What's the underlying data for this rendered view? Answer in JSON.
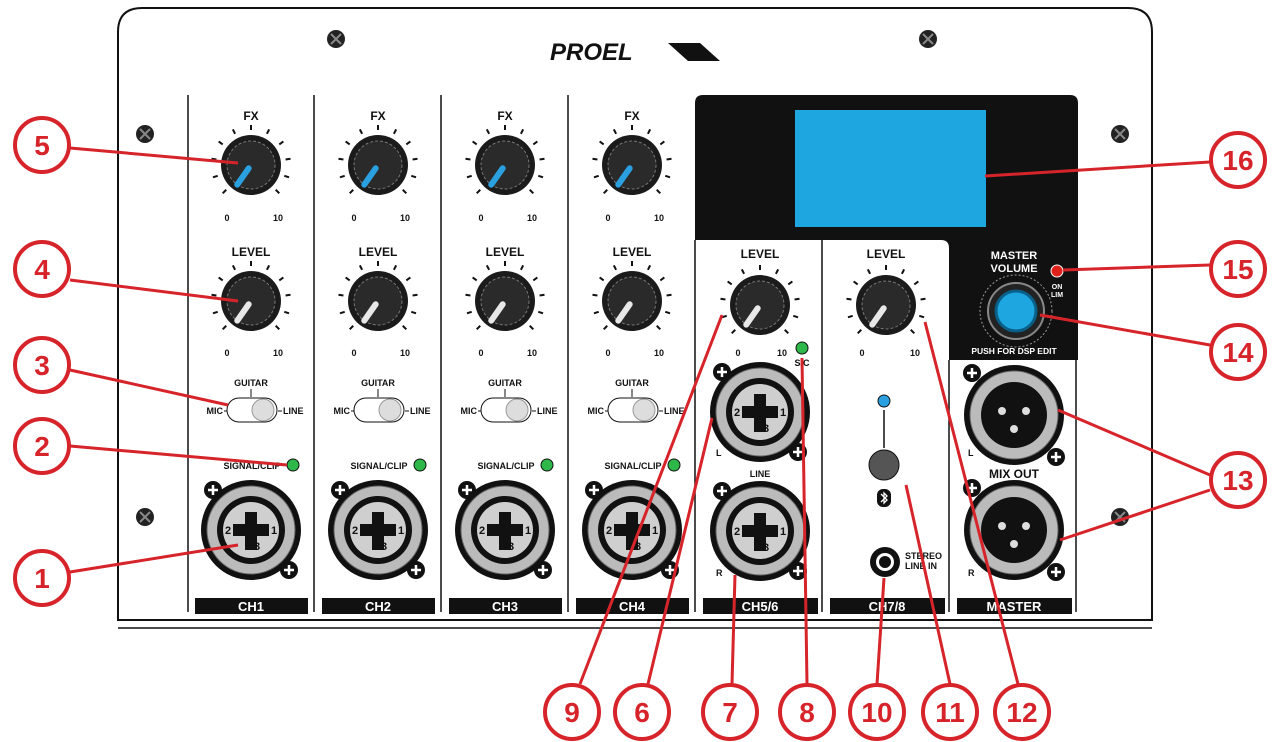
{
  "brand": "PROEL",
  "channels": [
    {
      "id": "CH1",
      "fx_label": "FX",
      "level_label": "LEVEL",
      "switch_top": "GUITAR",
      "switch_left": "MIC",
      "switch_right": "LINE",
      "signal_label": "SIGNAL/CLIP"
    },
    {
      "id": "CH2",
      "fx_label": "FX",
      "level_label": "LEVEL",
      "switch_top": "GUITAR",
      "switch_left": "MIC",
      "switch_right": "LINE",
      "signal_label": "SIGNAL/CLIP"
    },
    {
      "id": "CH3",
      "fx_label": "FX",
      "level_label": "LEVEL",
      "switch_top": "GUITAR",
      "switch_left": "MIC",
      "switch_right": "LINE",
      "signal_label": "SIGNAL/CLIP"
    },
    {
      "id": "CH4",
      "fx_label": "FX",
      "level_label": "LEVEL",
      "switch_top": "GUITAR",
      "switch_left": "MIC",
      "switch_right": "LINE",
      "signal_label": "SIGNAL/CLIP"
    }
  ],
  "scale": {
    "min": "0",
    "max": "10"
  },
  "ch56": {
    "id": "CH5/6",
    "level_label": "LEVEL",
    "sc_label": "S/C",
    "line_label": "LINE",
    "left_label": "L",
    "right_label": "R"
  },
  "ch78": {
    "id": "CH7/8",
    "level_label": "LEVEL",
    "stereo_line_in": [
      "STEREO",
      "LINE IN"
    ]
  },
  "master": {
    "id": "MASTER",
    "volume_label": [
      "MASTER",
      "VOLUME"
    ],
    "on_lim": [
      "ON",
      "LIM"
    ],
    "push_label": "PUSH FOR DSP EDIT",
    "mix_out": "MIX OUT",
    "left_label": "L",
    "right_label": "R"
  },
  "callouts": [
    "1",
    "2",
    "3",
    "4",
    "5",
    "6",
    "7",
    "8",
    "9",
    "10",
    "11",
    "12",
    "13",
    "14",
    "15",
    "16"
  ],
  "colors": {
    "callout": "#d6242a",
    "display": "#1ea6e0",
    "led_green": "#2eb84a",
    "led_red": "#e0201b",
    "led_blue": "#2aa0e0",
    "fx_pointer": "#2aa0e0",
    "level_pointer": "#e8e8e8"
  }
}
